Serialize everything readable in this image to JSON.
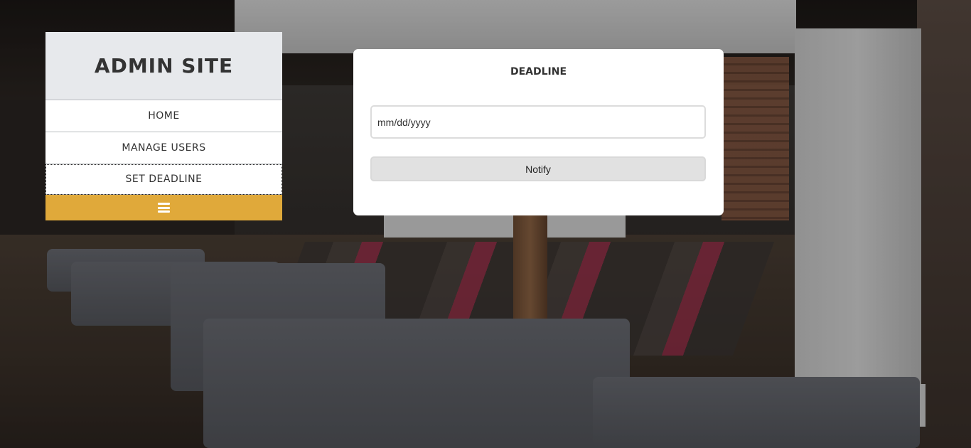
{
  "sidebar": {
    "title": "ADMIN SITE",
    "items": [
      {
        "label": "HOME"
      },
      {
        "label": "MANAGE USERS"
      },
      {
        "label": "SET DEADLINE",
        "active": true
      }
    ],
    "menu_toggle_icon": "hamburger-icon",
    "accent_color": "#e0a93a"
  },
  "deadline_card": {
    "title": "DEADLINE",
    "date_input": {
      "placeholder": "mm/dd/yyyy",
      "value": ""
    },
    "notify_label": "Notify"
  }
}
